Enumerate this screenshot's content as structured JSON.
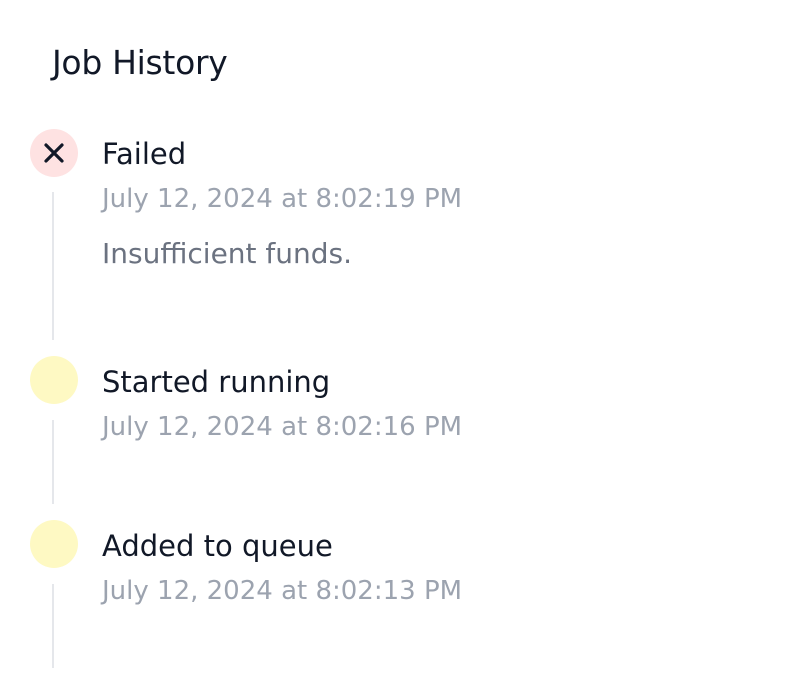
{
  "header": {
    "title": "Job History"
  },
  "events": [
    {
      "title": "Failed",
      "timestamp": "July 12, 2024 at 8:02:19 PM",
      "detail": "Insufficient funds.",
      "status": "failed",
      "icon": "close-icon",
      "color": "#fee2e2"
    },
    {
      "title": "Started running",
      "timestamp": "July 12, 2024 at 8:02:16 PM",
      "status": "running",
      "color": "#fef9c3"
    },
    {
      "title": "Added to queue",
      "timestamp": "July 12, 2024 at 8:02:13 PM",
      "status": "queued",
      "color": "#fef9c3"
    }
  ]
}
